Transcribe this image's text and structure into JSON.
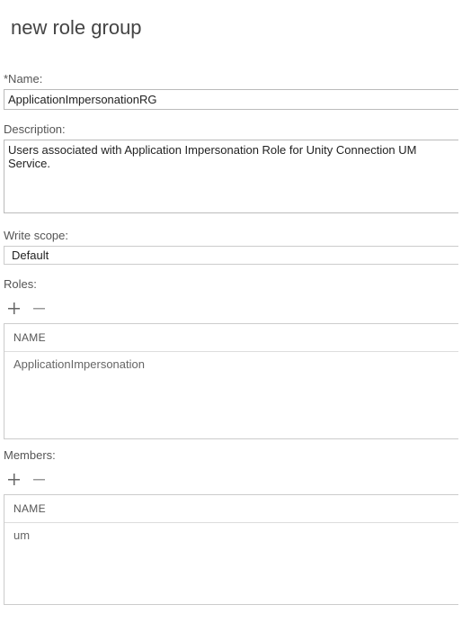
{
  "page": {
    "title": "new role group"
  },
  "name": {
    "label": "*Name:",
    "value": "ApplicationImpersonationRG"
  },
  "description": {
    "label": "Description:",
    "value": "Users associated with Application Impersonation Role for Unity Connection UM Service."
  },
  "writeScope": {
    "label": "Write scope:",
    "value": "Default"
  },
  "roles": {
    "label": "Roles:",
    "header": "NAME",
    "items": [
      "ApplicationImpersonation"
    ]
  },
  "members": {
    "label": "Members:",
    "header": "NAME",
    "items": [
      "um"
    ]
  }
}
